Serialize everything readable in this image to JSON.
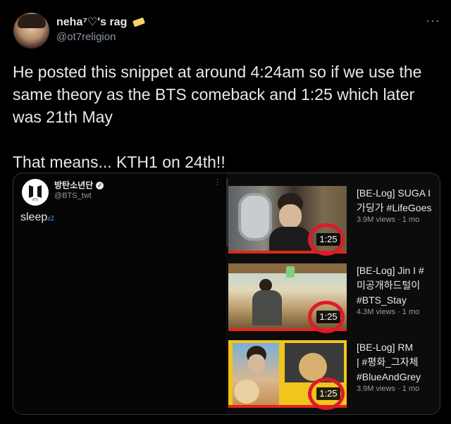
{
  "tweet": {
    "display_name": "neha⁷♡'s rag",
    "handle": "@ot7religion",
    "more_label": "···",
    "paragraph1": "He posted this snippet at around 4:24am so if we use the same theory as the BTS comeback and 1:25 which later was 21th May",
    "paragraph2": "That means... KTH1 on 24th!!"
  },
  "embedded": {
    "account_name": "방탄소년단",
    "account_handle": "@BTS_twt",
    "logo_label": "BTS",
    "post_text": "sleep",
    "post_suffix": "zZ",
    "more_label": "⋮"
  },
  "videos": [
    {
      "title": "[BE-Log] SUGA I\n가딩가 #LifeGoes",
      "views": "3.9M views · 1 mo",
      "duration": "1:25"
    },
    {
      "title": "[BE-Log] Jin I #\n미공개하드털이\n#BTS_Stay",
      "views": "4.3M views · 1 mo",
      "duration": "1:25"
    },
    {
      "title": "[BE-Log] RM\n| #평화_그자체\n#BlueAndGrey",
      "views": "3.9M views · 1 mo",
      "duration": "1:25"
    }
  ],
  "colors": {
    "accent_ring": "#e0192a",
    "progress_bar": "#e0261b",
    "background": "#000000"
  }
}
